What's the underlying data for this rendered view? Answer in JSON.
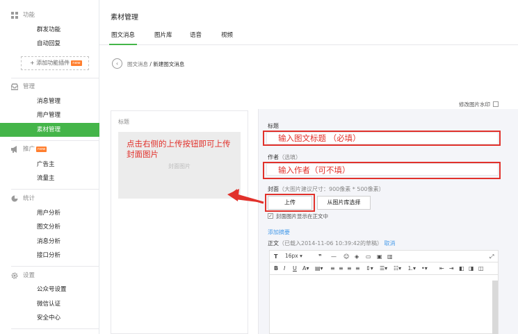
{
  "sidebar": {
    "groups": [
      {
        "title": "功能",
        "icon": "grid-icon",
        "items": [
          "群发功能",
          "自动回复"
        ]
      },
      {
        "title": "管理",
        "icon": "inbox-icon",
        "items": [
          "消息管理",
          "用户管理",
          "素材管理"
        ]
      },
      {
        "title": "推广",
        "icon": "megaphone-icon",
        "badge": "new",
        "items": [
          "广告主",
          "流量主"
        ]
      },
      {
        "title": "统计",
        "icon": "pie-chart-icon",
        "items": [
          "用户分析",
          "图文分析",
          "消息分析",
          "接口分析"
        ]
      },
      {
        "title": "设置",
        "icon": "gear-icon",
        "items": [
          "公众号设置",
          "微信认证",
          "安全中心"
        ]
      }
    ],
    "add_plugin": "+ 添加功能插件",
    "add_plugin_badge": "new",
    "active_item": "素材管理"
  },
  "main": {
    "title": "素材管理",
    "tabs": [
      "图文消息",
      "图片库",
      "语音",
      "视频"
    ],
    "active_tab": "图文消息",
    "breadcrumb": {
      "parent": "图文消息",
      "sep": " / ",
      "current": "新建图文消息"
    },
    "watermark_label": "修改图片水印"
  },
  "preview": {
    "title_placeholder": "标题",
    "cover_placeholder": "封面图片",
    "annotation": "点击右侧的上传按钮即可上传封面图片"
  },
  "editor": {
    "title_label": "标题",
    "title_annotation": "输入图文标题 （必填）",
    "author_label": "作者",
    "author_optional": "（选填）",
    "author_annotation": "输入作者（可不填）",
    "cover_label": "封面",
    "cover_hint": "（大图片建议尺寸：900像素 * 500像素）",
    "upload_button": "上传",
    "library_button": "从图片库选择",
    "show_cover_checkbox": "封面图片显示在正文中",
    "add_summary": "添加摘要",
    "body_label": "正文",
    "draft_note": "（已载入2014-11-06 10:39:42的草稿）",
    "cancel_link": "取消",
    "font_size": "16px"
  },
  "colors": {
    "accent": "#44b549",
    "annotation_red": "#e1312b",
    "link": "#459ae9"
  }
}
